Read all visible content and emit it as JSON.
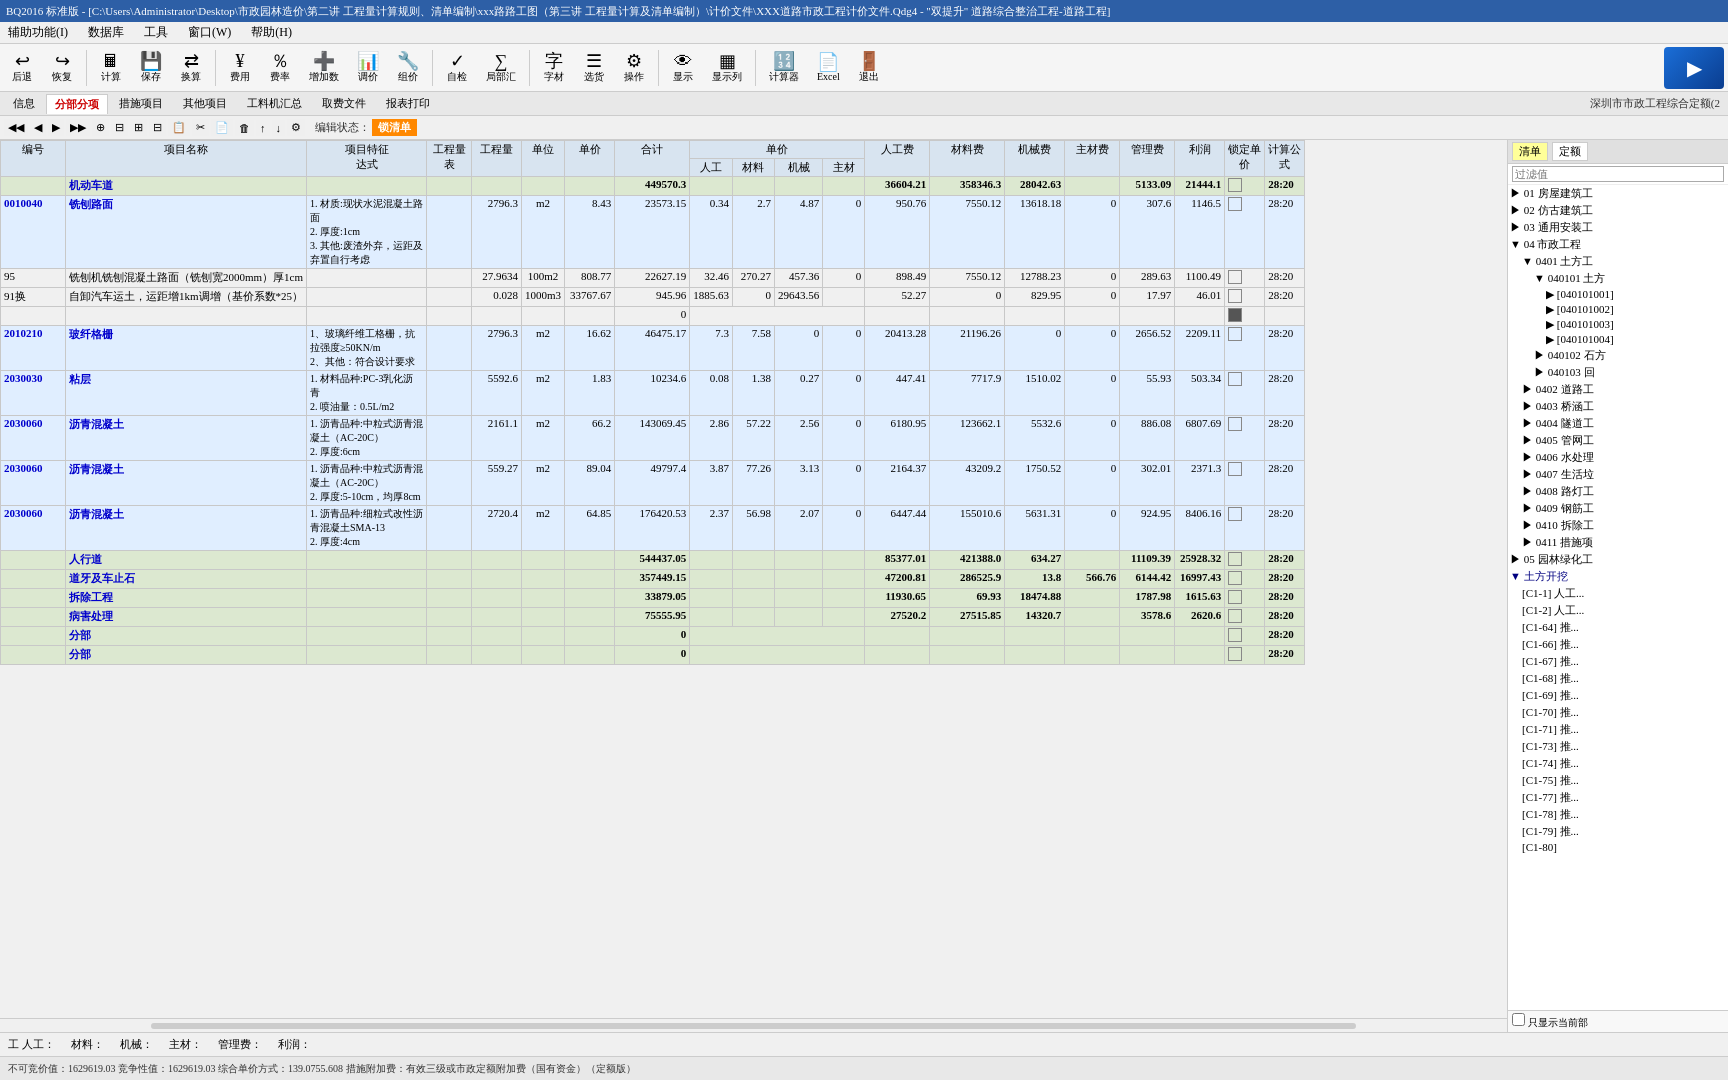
{
  "title": "BQ2016 标准版 - [C:\\Users\\Administrator\\Desktop\\市政园林造价\\第二讲 工程量计算规则、清单编制\\xxx路路工图（第三讲 工程量计算及清单编制）\\计价文件\\XXX道路市政工程计价文件.Qdg4 - \"双提升\" 道路综合整治工程-道路工程]",
  "menu": {
    "items": [
      "辅助功能(I)",
      "数据库",
      "工具",
      "窗口(W)",
      "帮助(H)"
    ]
  },
  "toolbar": {
    "buttons": [
      {
        "label": "后退",
        "icon": "↩"
      },
      {
        "label": "恢复",
        "icon": "↪"
      },
      {
        "label": "计算",
        "icon": "🖩"
      },
      {
        "label": "保存",
        "icon": "💾"
      },
      {
        "label": "换算",
        "icon": "⇄"
      },
      {
        "label": "费用",
        "icon": "¥"
      },
      {
        "label": "费率",
        "icon": "％"
      },
      {
        "label": "增加数",
        "icon": "➕"
      },
      {
        "label": "调价",
        "icon": "📊"
      },
      {
        "label": "组价",
        "icon": "🔧"
      },
      {
        "label": "自检",
        "icon": "✓"
      },
      {
        "label": "局部汇",
        "icon": "∑"
      },
      {
        "label": "字材",
        "icon": "字"
      },
      {
        "label": "选货",
        "icon": "☰"
      },
      {
        "label": "操作",
        "icon": "⚙"
      },
      {
        "label": "显示",
        "icon": "👁"
      },
      {
        "label": "显示列",
        "icon": "▦"
      },
      {
        "label": "计算器",
        "icon": "🔢"
      },
      {
        "label": "Excel",
        "icon": "📄"
      },
      {
        "label": "退出",
        "icon": "🚪"
      }
    ]
  },
  "tabs": {
    "items": [
      "信息",
      "分部分项",
      "措施项目",
      "其他项目",
      "工料机汇总",
      "取费文件",
      "报表打印"
    ]
  },
  "active_tab": "分部分项",
  "top_right_label": "深圳市市政工程综合定额(2",
  "toolbar2": {
    "buttons": [
      "◀",
      "▶",
      "◀◀",
      "▶▶",
      "⊕",
      "⊟",
      "⊞",
      "⊟",
      "📋",
      "✂",
      "📄",
      "🗑",
      "↑",
      "↓",
      "⚙"
    ],
    "status_label": "编辑状态：",
    "lock_status": "锁清单"
  },
  "table": {
    "columns": [
      {
        "id": "code",
        "label": "编号",
        "width": 70
      },
      {
        "id": "name",
        "label": "项目名称",
        "width": 100
      },
      {
        "id": "feature",
        "label": "项目特征\n达式",
        "width": 120
      },
      {
        "id": "qty",
        "label": "工程量",
        "width": 55
      },
      {
        "id": "unit",
        "label": "单位",
        "width": 30
      },
      {
        "id": "unit_price",
        "label": "单价",
        "width": 55
      },
      {
        "id": "total",
        "label": "合计",
        "width": 80
      },
      {
        "id": "labor",
        "label": "人工",
        "width": 50
      },
      {
        "id": "material",
        "label": "材料",
        "width": 50
      },
      {
        "id": "machine",
        "label": "机械",
        "width": 50
      },
      {
        "id": "main_material",
        "label": "主材",
        "width": 50
      },
      {
        "id": "labor_fee",
        "label": "人工费",
        "width": 75
      },
      {
        "id": "material_fee",
        "label": "材料费",
        "width": 80
      },
      {
        "id": "machine_fee",
        "label": "机械费",
        "width": 65
      },
      {
        "id": "main_fee",
        "label": "主材费",
        "width": 65
      },
      {
        "id": "mgmt_fee",
        "label": "管理费",
        "width": 60
      },
      {
        "id": "profit",
        "label": "利润",
        "width": 55
      },
      {
        "id": "lock_price",
        "label": "锁定单\n价",
        "width": 35
      },
      {
        "id": "calc",
        "label": "计算公\n式",
        "width": 35
      }
    ],
    "rows": [
      {
        "type": "category",
        "code": "",
        "name": "机动车道",
        "feature": "",
        "qty": "",
        "unit": "",
        "unit_price": "",
        "total": "449570.3",
        "labor": "",
        "material": "",
        "machine": "",
        "main_material": "",
        "labor_fee": "36604.21",
        "material_fee": "358346.3",
        "machine_fee": "28042.63",
        "main_fee": "",
        "mgmt_fee": "5133.09",
        "profit": "21444.1",
        "lock": false,
        "calc": "28:20"
      },
      {
        "type": "item",
        "code": "0010040",
        "name": "铣刨路面",
        "feature": "1. 材质:现状水泥混凝土路面\n2. 厚度:1cm\n3. 其他:废渣外弃，运距及弃置自行考虑",
        "qty": "2796.3",
        "unit": "m2",
        "unit_price": "8.43",
        "total": "23573.15",
        "labor": "0.34",
        "material": "2.7",
        "machine": "4.87",
        "main_material": "0",
        "labor_fee": "950.76",
        "material_fee": "7550.12",
        "machine_fee": "13618.18",
        "main_fee": "0",
        "mgmt_fee": "307.6",
        "profit": "1146.5",
        "lock": false,
        "calc": "28:20"
      },
      {
        "type": "sub",
        "code": "95",
        "name": "铣刨机铣刨混凝土路面（铣刨宽2000mm）厚1cm",
        "feature": "",
        "qty": "27.9634",
        "unit": "100m2",
        "unit_price": "808.77",
        "total": "22627.19",
        "labor": "32.46",
        "material": "270.27",
        "machine": "457.36",
        "main_material": "0",
        "labor_fee": "898.49",
        "material_fee": "7550.12",
        "machine_fee": "12788.23",
        "main_fee": "0",
        "mgmt_fee": "289.63",
        "profit": "1100.49",
        "lock": false,
        "calc": "28:20"
      },
      {
        "type": "sub",
        "code": "91换",
        "name": "自卸汽车运土，运距增1km调增（基价系数*25）",
        "feature": "",
        "qty": "0.028",
        "unit": "1000m3",
        "unit_price": "33767.67",
        "total": "945.96",
        "labor": "1885.63",
        "material": "0",
        "machine": "",
        "main_material": "29643.56",
        "labor_fee": "52.27",
        "material_fee": "0",
        "machine_fee": "829.95",
        "main_fee": "0",
        "mgmt_fee": "17.97",
        "profit": "46.01",
        "lock": false,
        "calc": "28:20"
      },
      {
        "type": "zero",
        "code": "",
        "name": "",
        "total": "0",
        "lock": false,
        "calc": ""
      },
      {
        "type": "item",
        "code": "2010210",
        "name": "玻纤格栅",
        "feature": "1、玻璃纤维工格栅，抗拉强度≥50KN/m\n2、其他：符合设计要求",
        "qty": "2796.3",
        "unit": "m2",
        "unit_price": "16.62",
        "total": "46475.17",
        "labor": "7.3",
        "material": "7.58",
        "machine": "0",
        "main_material": "0",
        "labor_fee": "20413.28",
        "material_fee": "21196.26",
        "machine_fee": "0",
        "main_fee": "0",
        "mgmt_fee": "2656.52",
        "profit": "2209.11",
        "lock": false,
        "calc": "28:20"
      },
      {
        "type": "item",
        "code": "2030030",
        "name": "粘层",
        "feature": "1. 材料品种:PC-3乳化沥青\n2. 喷油量：0.5L/m2",
        "qty": "5592.6",
        "unit": "m2",
        "unit_price": "1.83",
        "total": "10234.6",
        "labor": "0.08",
        "material": "1.38",
        "machine": "0.27",
        "main_material": "0",
        "labor_fee": "447.41",
        "material_fee": "7717.9",
        "machine_fee": "1510.02",
        "main_fee": "0",
        "mgmt_fee": "55.93",
        "profit": "503.34",
        "lock": false,
        "calc": "28:20"
      },
      {
        "type": "item",
        "code": "2030060",
        "name": "沥青混凝土",
        "feature": "1. 沥青品种:中粒式沥青混凝土（AC-20C）\n2. 厚度:6cm",
        "qty": "2161.1",
        "unit": "m2",
        "unit_price": "66.2",
        "total": "143069.45",
        "labor": "2.86",
        "material": "57.22",
        "machine": "2.56",
        "main_material": "0",
        "labor_fee": "6180.95",
        "material_fee": "123662.1",
        "machine_fee": "5532.6",
        "main_fee": "0",
        "mgmt_fee": "886.08",
        "profit": "6807.69",
        "lock": false,
        "calc": "28:20"
      },
      {
        "type": "item",
        "code": "2030060",
        "name": "沥青混凝土",
        "feature": "1. 沥青品种:中粒式沥青混凝土（AC-20C）\n2. 厚度:5-10cm，均厚8cm",
        "qty": "559.27",
        "unit": "m2",
        "unit_price": "89.04",
        "total": "49797.4",
        "labor": "3.87",
        "material": "77.26",
        "machine": "3.13",
        "main_material": "0",
        "labor_fee": "2164.37",
        "material_fee": "43209.2",
        "machine_fee": "1750.52",
        "main_fee": "0",
        "mgmt_fee": "302.01",
        "profit": "2371.3",
        "lock": false,
        "calc": "28:20"
      },
      {
        "type": "item",
        "code": "2030060",
        "name": "沥青混凝土",
        "feature": "1. 沥青品种:细粒式改性沥青混凝土SMA-13\n2. 厚度:4cm",
        "qty": "2720.4",
        "unit": "m2",
        "unit_price": "64.85",
        "total": "176420.53",
        "labor": "2.37",
        "material": "56.98",
        "machine": "2.07",
        "main_material": "0",
        "labor_fee": "6447.44",
        "material_fee": "155010.6",
        "machine_fee": "5631.31",
        "main_fee": "0",
        "mgmt_fee": "924.95",
        "profit": "8406.16",
        "lock": false,
        "calc": "28:20"
      },
      {
        "type": "summary",
        "code": "",
        "name": "人行道",
        "total": "544437.05",
        "labor_fee": "85377.01",
        "material_fee": "421388.0",
        "machine_fee": "634.27",
        "mgmt_fee": "11109.39",
        "profit": "25928.32",
        "calc": "28:20"
      },
      {
        "type": "summary",
        "code": "",
        "name": "道牙及车止石",
        "total": "357449.15",
        "labor_fee": "47200.81",
        "material_fee": "286525.9",
        "machine_fee": "13.8",
        "main_fee": "566.76",
        "mgmt_fee": "6144.42",
        "profit": "16997.43",
        "calc": "28:20"
      },
      {
        "type": "summary",
        "code": "",
        "name": "拆除工程",
        "total": "33879.05",
        "labor_fee": "11930.65",
        "material_fee": "69.93",
        "machine_fee": "18474.88",
        "mgmt_fee": "1787.98",
        "profit": "1615.63",
        "calc": "28:20"
      },
      {
        "type": "summary",
        "code": "",
        "name": "病害处理",
        "total": "75555.95",
        "labor_fee": "27520.2",
        "material_fee": "27515.85",
        "machine_fee": "14320.7",
        "mgmt_fee": "3578.6",
        "profit": "2620.6",
        "calc": "28:20"
      },
      {
        "type": "subtotal",
        "code": "",
        "name": "分部",
        "total": "0",
        "calc": "28:20"
      },
      {
        "type": "subtotal",
        "code": "",
        "name": "分部",
        "total": "0",
        "calc": "28:20"
      }
    ]
  },
  "right_panel": {
    "tabs": [
      "清单",
      "定额"
    ],
    "filter_placeholder": "过滤值",
    "tree": [
      {
        "id": "01",
        "label": "01 房屋建筑工",
        "level": 0,
        "expanded": false
      },
      {
        "id": "02",
        "label": "02 仿古建筑工",
        "level": 0,
        "expanded": false
      },
      {
        "id": "03",
        "label": "03 通用安装工",
        "level": 0,
        "expanded": false
      },
      {
        "id": "04",
        "label": "04 市政工程",
        "level": 0,
        "expanded": true
      },
      {
        "id": "0401",
        "label": "0401 土方工",
        "level": 1,
        "expanded": true
      },
      {
        "id": "040101",
        "label": "040101 土方",
        "level": 2,
        "expanded": true
      },
      {
        "id": "040101_1",
        "label": "[040101001]",
        "level": 3,
        "expanded": false
      },
      {
        "id": "040101_2",
        "label": "[040101002]",
        "level": 3,
        "expanded": false
      },
      {
        "id": "040101_3",
        "label": "[040101003]",
        "level": 3,
        "expanded": false
      },
      {
        "id": "040101_4",
        "label": "[040101004]",
        "level": 3,
        "expanded": false
      },
      {
        "id": "040102",
        "label": "040102 石方",
        "level": 2,
        "expanded": false
      },
      {
        "id": "040103",
        "label": "040103 回",
        "level": 2,
        "expanded": false
      },
      {
        "id": "0402",
        "label": "0402 道路工",
        "level": 1,
        "expanded": false
      },
      {
        "id": "0403",
        "label": "0403 桥涵工",
        "level": 1,
        "expanded": false
      },
      {
        "id": "0404",
        "label": "0404 隧道工",
        "level": 1,
        "expanded": false
      },
      {
        "id": "0405",
        "label": "0405 管网工",
        "level": 1,
        "expanded": false
      },
      {
        "id": "0406",
        "label": "0406 水处理",
        "level": 1,
        "expanded": false
      },
      {
        "id": "0407",
        "label": "0407 生活垃",
        "level": 1,
        "expanded": false
      },
      {
        "id": "0408",
        "label": "0408 路灯工",
        "level": 1,
        "expanded": false
      },
      {
        "id": "0409",
        "label": "0409 钢筋工",
        "level": 1,
        "expanded": false
      },
      {
        "id": "0410",
        "label": "0410 拆除工",
        "level": 1,
        "expanded": false
      },
      {
        "id": "0411",
        "label": "0411 措施项",
        "level": 1,
        "expanded": false
      },
      {
        "id": "05",
        "label": "05 园林绿化工",
        "level": 0,
        "expanded": false
      },
      {
        "id": "土方开挖",
        "label": "土方开挖",
        "level": 0,
        "expanded": true,
        "color": "#000080"
      },
      {
        "id": "c1-1",
        "label": "[C1-1] 人工...",
        "level": 1
      },
      {
        "id": "c1-2",
        "label": "[C1-2] 人工...",
        "level": 1
      },
      {
        "id": "c1-64",
        "label": "[C1-64] 推...",
        "level": 1
      },
      {
        "id": "c1-66",
        "label": "[C1-66] 推...",
        "level": 1
      },
      {
        "id": "c1-67",
        "label": "[C1-67] 推...",
        "level": 1
      },
      {
        "id": "c1-68",
        "label": "[C1-68] 推...",
        "level": 1
      },
      {
        "id": "c1-69",
        "label": "[C1-69] 推...",
        "level": 1
      },
      {
        "id": "c1-70",
        "label": "[C1-70] 推...",
        "level": 1
      },
      {
        "id": "c1-71",
        "label": "[C1-71] 推...",
        "level": 1
      },
      {
        "id": "c1-73",
        "label": "[C1-73] 推...",
        "level": 1
      },
      {
        "id": "c1-74",
        "label": "[C1-74] 推...",
        "level": 1
      },
      {
        "id": "c1-75",
        "label": "[C1-75] 推...",
        "level": 1
      },
      {
        "id": "c1-77",
        "label": "[C1-77] 推...",
        "level": 1
      },
      {
        "id": "c1-78",
        "label": "[C1-78] 推...",
        "level": 1
      },
      {
        "id": "c1-79",
        "label": "[C1-79] 推...",
        "level": 1
      },
      {
        "id": "c1-80",
        "label": "[C1-80]",
        "level": 1
      }
    ]
  },
  "status_bar": {
    "items": [
      "工 人工：",
      "材料：",
      "机械：",
      "主材：",
      "管理费：",
      "利润："
    ]
  },
  "bottom_bar": {
    "text": "不可竞价值：1629619.03 竞争性值：1629619.03 综合单价方式：139.0755.608 措施附加费：有效三级或市政定额附加费（国有资金）（定额版）",
    "checkbox_label": "只显示当前部"
  }
}
